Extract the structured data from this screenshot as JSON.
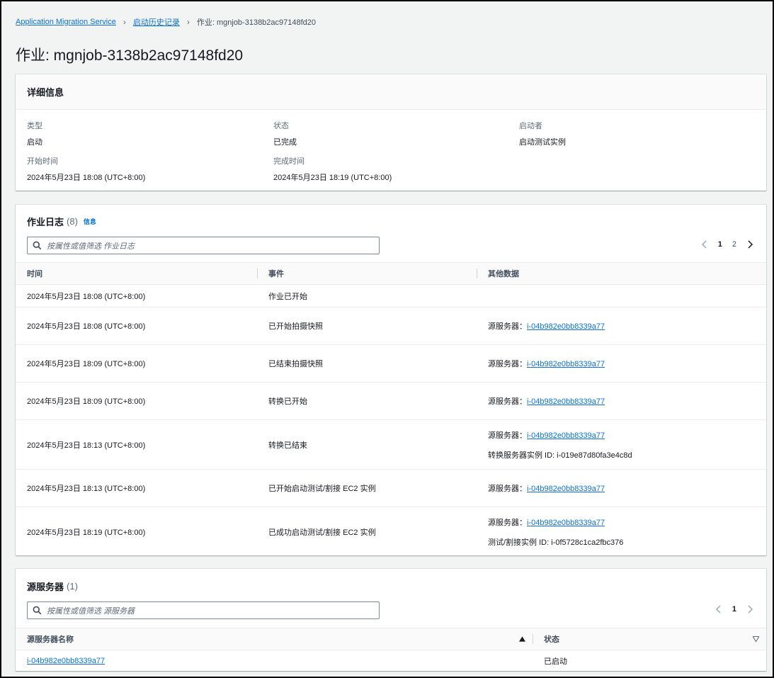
{
  "breadcrumb": {
    "items": [
      "Application Migration Service",
      "启动历史记录"
    ],
    "current": "作业: mgnjob-3138b2ac97148fd20"
  },
  "page_title": "作业: mgnjob-3138b2ac97148fd20",
  "details": {
    "title": "详细信息",
    "fields": [
      {
        "label": "类型",
        "value": "启动"
      },
      {
        "label": "状态",
        "value": "已完成"
      },
      {
        "label": "启动者",
        "value": "启动测试实例"
      },
      {
        "label": "开始时间",
        "value": "2024年5月23日 18:08 (UTC+8:00)"
      },
      {
        "label": "完成时间",
        "value": "2024年5月23日 18:19 (UTC+8:00)"
      }
    ]
  },
  "logs": {
    "title": "作业日志",
    "count": "(8)",
    "info_label": "信息",
    "search_placeholder": "按属性或值筛选 作业日志",
    "pages": [
      "1",
      "2"
    ],
    "columns": [
      "时间",
      "事件",
      "其他数据"
    ],
    "source_label": "源服务器：",
    "rows": [
      {
        "time": "2024年5月23日 18:08 (UTC+8:00)",
        "event": "作业已开始",
        "source": "",
        "extra": ""
      },
      {
        "time": "2024年5月23日 18:08 (UTC+8:00)",
        "event": "已开始拍摄快照",
        "source": "i-04b982e0bb8339a77",
        "extra": ""
      },
      {
        "time": "2024年5月23日 18:09 (UTC+8:00)",
        "event": "已结束拍摄快照",
        "source": "i-04b982e0bb8339a77",
        "extra": ""
      },
      {
        "time": "2024年5月23日 18:09 (UTC+8:00)",
        "event": "转换已开始",
        "source": "i-04b982e0bb8339a77",
        "extra": ""
      },
      {
        "time": "2024年5月23日 18:13 (UTC+8:00)",
        "event": "转换已结束",
        "source": "i-04b982e0bb8339a77",
        "extra": "转换服务器实例 ID: i-019e87d80fa3e4c8d"
      },
      {
        "time": "2024年5月23日 18:13 (UTC+8:00)",
        "event": "已开始启动测试/割接 EC2 实例",
        "source": "i-04b982e0bb8339a77",
        "extra": ""
      },
      {
        "time": "2024年5月23日 18:19 (UTC+8:00)",
        "event": "已成功启动测试/割接 EC2 实例",
        "source": "i-04b982e0bb8339a77",
        "extra": "测试/割接实例 ID: i-0f5728c1ca2fbc376"
      }
    ]
  },
  "servers": {
    "title": "源服务器",
    "count": "(1)",
    "search_placeholder": "按属性或值筛选 源服务器",
    "pages": [
      "1"
    ],
    "columns": [
      "源服务器名称",
      "状态"
    ],
    "rows": [
      {
        "name": "i-04b982e0bb8339a77",
        "status": "已启动"
      }
    ]
  }
}
